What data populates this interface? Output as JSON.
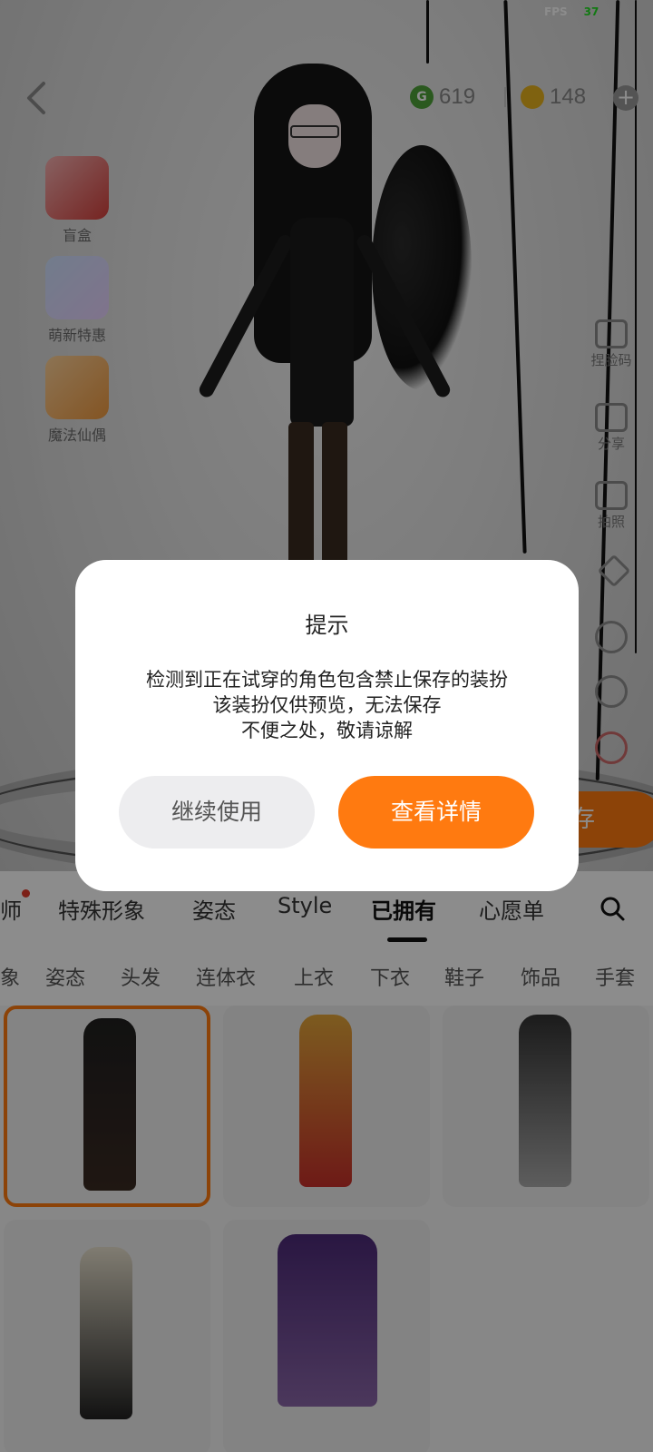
{
  "status": {
    "fps_label": "FPS",
    "fps_value": "37"
  },
  "topbar": {
    "currency_g": {
      "icon": "G",
      "amount": "619"
    },
    "currency_gold": {
      "amount": "148"
    },
    "plus": "+"
  },
  "promos": [
    {
      "label": "盲盒"
    },
    {
      "label": "萌新特惠"
    },
    {
      "label": "魔法仙偶"
    }
  ],
  "tools": [
    {
      "label": "捏脸码"
    },
    {
      "label": "分享"
    },
    {
      "label": "拍照"
    }
  ],
  "save_peek": "存",
  "tabs": [
    {
      "label": "师"
    },
    {
      "label": "特殊形象"
    },
    {
      "label": "姿态"
    },
    {
      "label": "Style"
    },
    {
      "label": "已拥有"
    },
    {
      "label": "心愿单"
    }
  ],
  "subtabs": [
    {
      "label": "象"
    },
    {
      "label": "姿态"
    },
    {
      "label": "头发"
    },
    {
      "label": "连体衣"
    },
    {
      "label": "上衣"
    },
    {
      "label": "下衣"
    },
    {
      "label": "鞋子"
    },
    {
      "label": "饰品"
    },
    {
      "label": "手套"
    }
  ],
  "dialog": {
    "title": "提示",
    "lines": [
      "检测到正在试穿的角色包含禁止保存的装扮",
      "该装扮仅供预览，无法保存",
      "不便之处，敬请谅解"
    ],
    "continue_label": "继续使用",
    "details_label": "查看详情"
  },
  "colors": {
    "accent": "#ff7a10",
    "dialog_bg": "#ffffff",
    "secondary_button": "#ededef"
  }
}
